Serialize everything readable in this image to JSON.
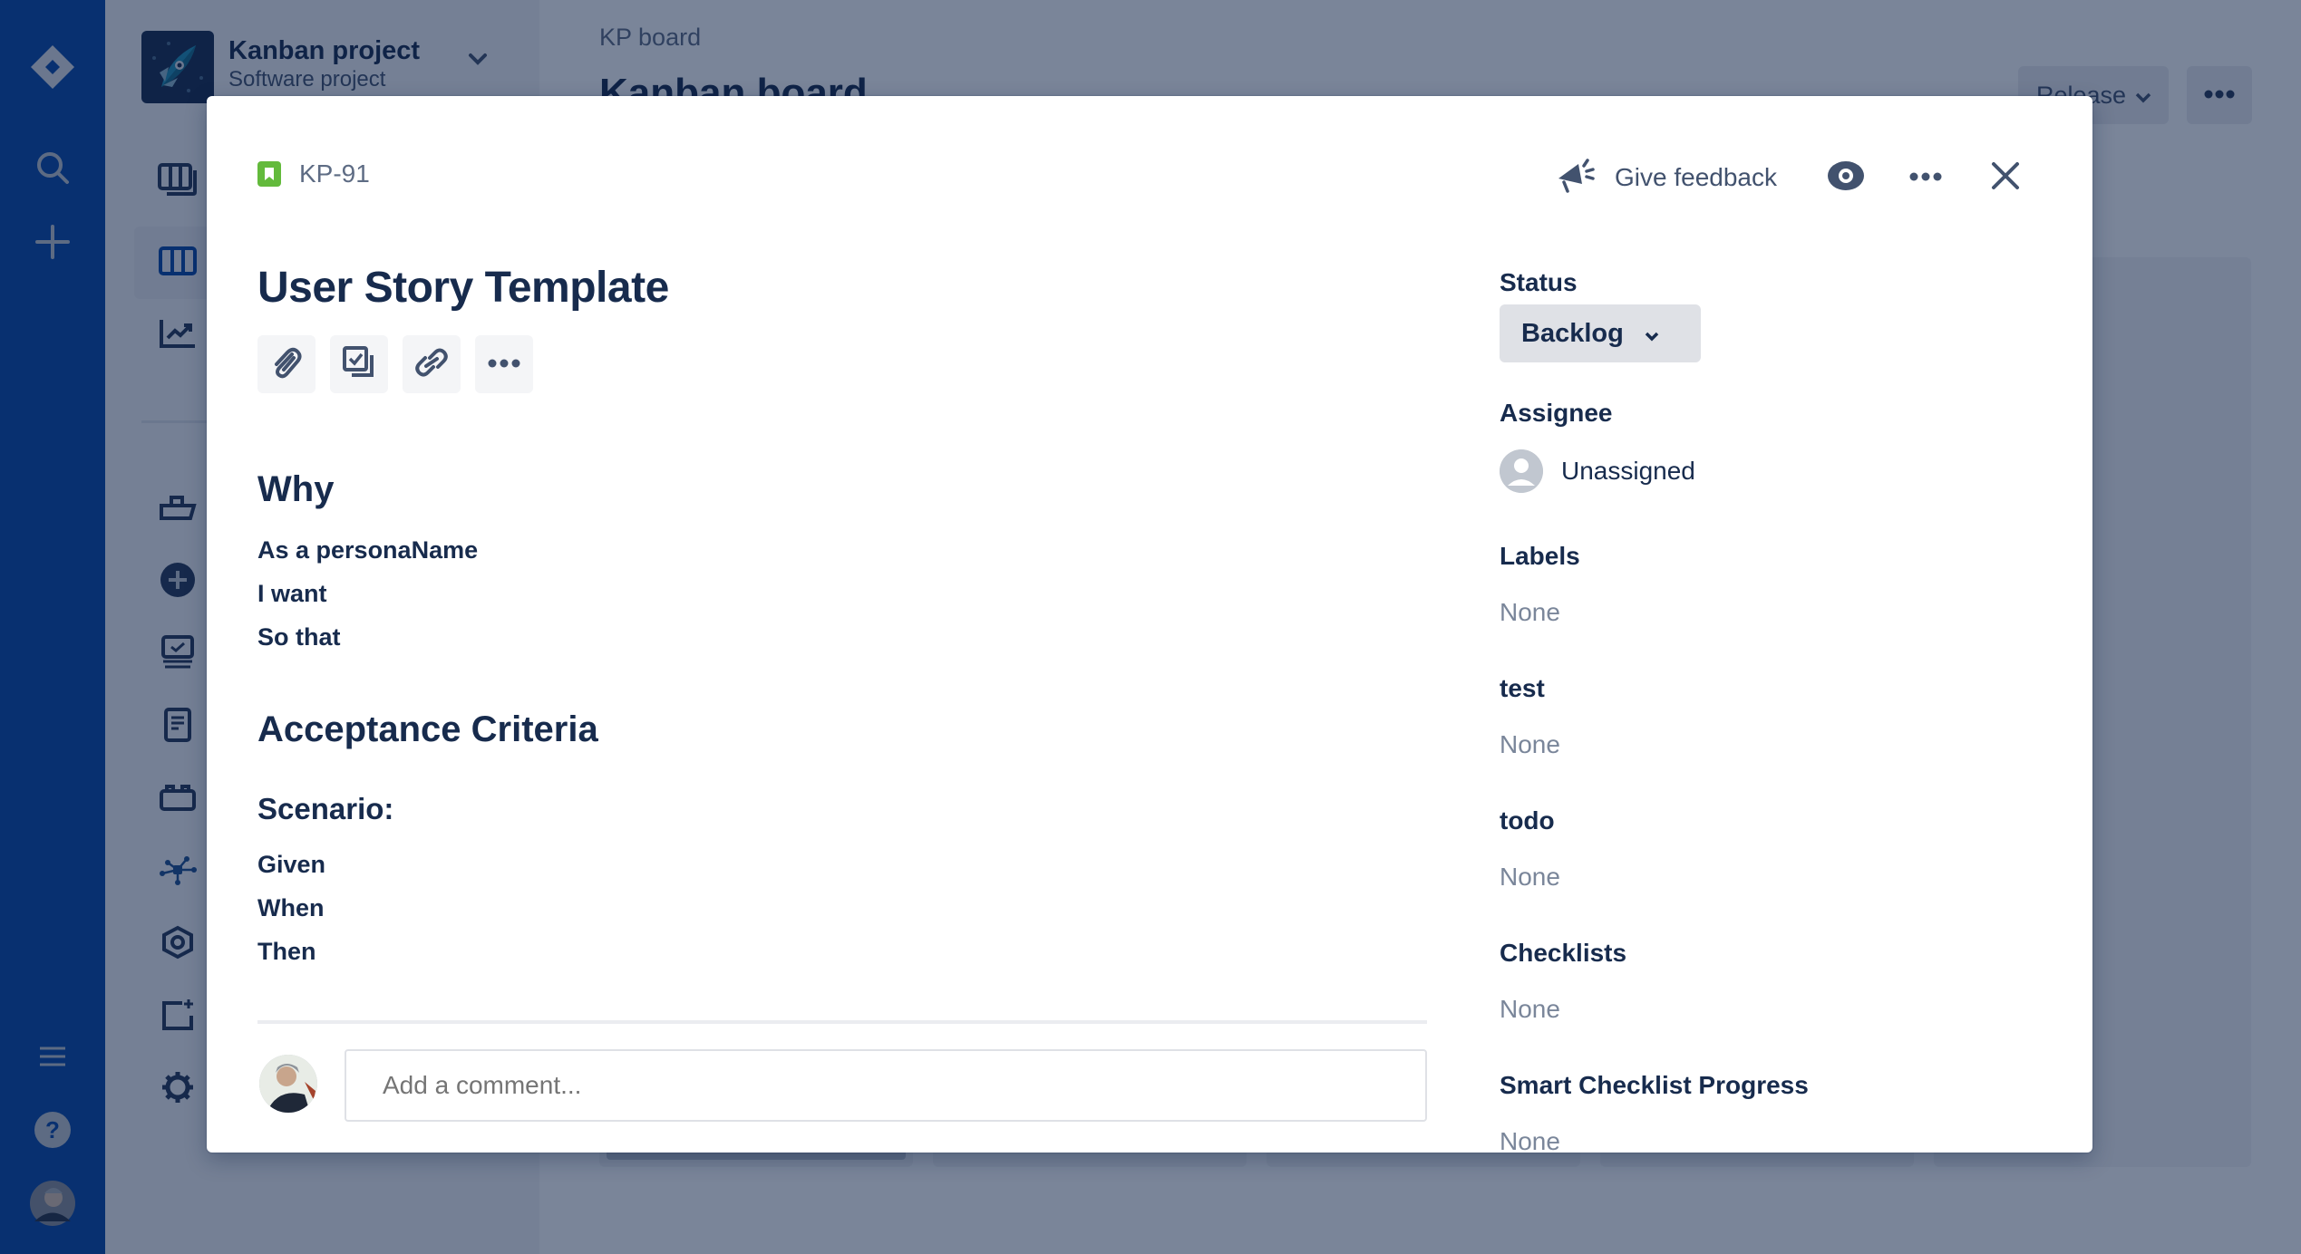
{
  "project": {
    "name": "Kanban project",
    "type": "Software project"
  },
  "global_nav": {
    "items": [
      {
        "name": "jira-logo",
        "icon": "jira-logo-icon"
      },
      {
        "name": "search",
        "icon": "search-icon"
      },
      {
        "name": "create",
        "icon": "plus-icon"
      },
      {
        "name": "menu",
        "icon": "hamburger-icon"
      },
      {
        "name": "help",
        "icon": "help-icon"
      },
      {
        "name": "profile",
        "icon": "avatar"
      }
    ]
  },
  "project_sidebar": {
    "items": [
      {
        "name": "backlog",
        "icon": "backlog-icon"
      },
      {
        "name": "kanban-board",
        "icon": "board-icon",
        "active": true
      },
      {
        "name": "reports",
        "icon": "reports-icon"
      },
      {
        "name": "releases",
        "icon": "ship-icon"
      },
      {
        "name": "add-item",
        "icon": "add-circle-icon"
      },
      {
        "name": "issues",
        "icon": "issues-icon"
      },
      {
        "name": "pages",
        "icon": "page-icon"
      },
      {
        "name": "components",
        "icon": "components-icon"
      },
      {
        "name": "app",
        "icon": "network-icon"
      },
      {
        "name": "app-2",
        "icon": "hexagon-icon"
      },
      {
        "name": "add-shortcut",
        "icon": "add-shortcut-icon"
      },
      {
        "name": "project-settings",
        "icon": "gear-icon"
      }
    ]
  },
  "board": {
    "breadcrumb": "KP board",
    "title": "Kanban board",
    "release_label": "Release",
    "more_label": "More"
  },
  "issue": {
    "key": "KP-91",
    "type": "Story",
    "title": "User Story Template",
    "header_actions": {
      "feedback_label": "Give feedback"
    },
    "toolbar": [
      {
        "name": "attach",
        "icon": "paperclip-icon"
      },
      {
        "name": "create-subtask",
        "icon": "subtask-icon"
      },
      {
        "name": "link-issue",
        "icon": "link-icon"
      },
      {
        "name": "more",
        "icon": "more-icon"
      }
    ],
    "description": {
      "why_heading": "Why",
      "why_lines": [
        "As a personaName",
        "I want",
        "So that"
      ],
      "ac_heading": "Acceptance Criteria",
      "scenario_heading": "Scenario:",
      "scenario_lines": [
        "Given",
        "When",
        "Then"
      ]
    },
    "comment": {
      "placeholder": "Add a comment..."
    },
    "fields": {
      "status": {
        "label": "Status",
        "value": "Backlog"
      },
      "assignee": {
        "label": "Assignee",
        "value": "Unassigned"
      },
      "labels": {
        "label": "Labels",
        "value": "None"
      },
      "test": {
        "label": "test",
        "value": "None"
      },
      "todo": {
        "label": "todo",
        "value": "None"
      },
      "checklists": {
        "label": "Checklists",
        "value": "None"
      },
      "smart_checklist_progress": {
        "label": "Smart Checklist Progress",
        "value": "None"
      }
    }
  },
  "colors": {
    "global_nav": "#0747a6",
    "story_type": "#63ba3c",
    "text_primary": "#172b4d",
    "text_subtle": "#5e6c84",
    "placeholder": "#7a869a",
    "status_bg": "#dfe1e6"
  }
}
